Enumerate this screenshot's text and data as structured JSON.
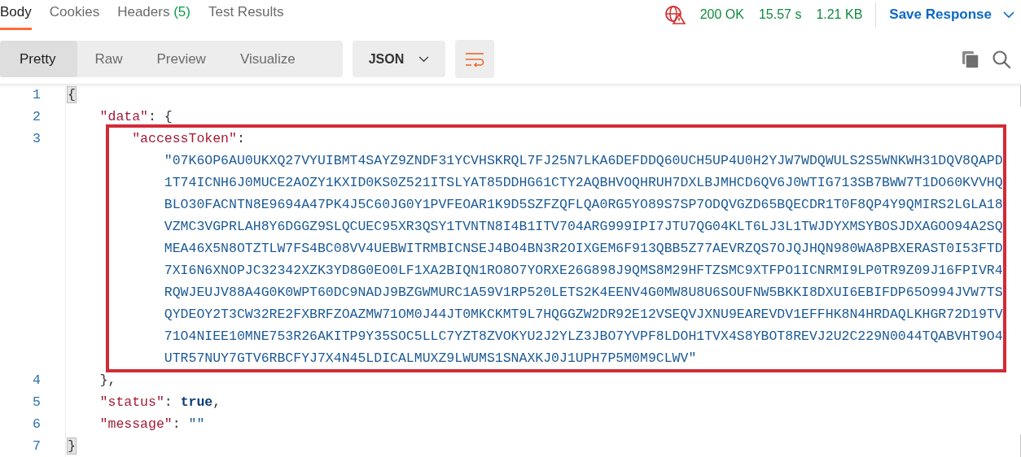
{
  "response_tabs": [
    {
      "label": "Body",
      "selected": true
    },
    {
      "label": "Cookies",
      "selected": false
    },
    {
      "label": "Headers",
      "count": "(5)",
      "selected": false
    },
    {
      "label": "Test Results",
      "selected": false
    }
  ],
  "response_status": {
    "code": "200 OK",
    "time": "15.57 s",
    "size": "1.21 KB"
  },
  "save_button": {
    "label": "Save Response"
  },
  "view_tabs": [
    {
      "label": "Pretty",
      "selected": true
    },
    {
      "label": "Raw",
      "selected": false
    },
    {
      "label": "Preview",
      "selected": false
    },
    {
      "label": "Visualize",
      "selected": false
    }
  ],
  "format_select": {
    "value": "JSON"
  },
  "wrap_toggle": {
    "on": true
  },
  "code": {
    "number": "1",
    "segments": [
      {
        "kind": "punct",
        "text": "{",
        "bracket_match": true
      }
    ],
    "children": [
      {
        "number": "2",
        "segments": [
          {
            "kind": "key",
            "text": "\"data\""
          },
          {
            "kind": "punct",
            "text": ": {"
          }
        ],
        "children": [
          {
            "number": "3",
            "highlighted": true,
            "segments": [
              {
                "kind": "key",
                "text": "\"accessToken\""
              },
              {
                "kind": "punct",
                "text": ":"
              }
            ],
            "wrapped_lines": [
              "\"07K6OP6AU0UKXQ27VYUIBMT4SAYZ9ZNDF31YCVHSKRQL7FJ25N7LKA6DEFDDQ60UCH5UP4U0H2YJW7WDQWULS2S5WNKWH31DQV8QAPD",
              "1T74ICNH6J0MUCE2AOZY1KXID0KS0Z521ITSLYAT85DDHG61CTY2AQBHVOQHRUH7DXLBJMHCD6QV6J0WTIG713SB7BWW7T1DO60KVVHQ",
              "BLO30FACNTN8E9694A47PK4J5C60JG0Y1PVFEOAR1K9D5SZFZQFLQA0RG5YO89S7SP7ODQVGZD65BQECDR1T0F8QP4Y9QMIRS2LGLA18",
              "VZMC3VGPRLAH8Y6DGGZ9SLQCUEC95XR3QSY1TVNTN8I4B1ITV704ARG999IPI7JTU7QG04KLT6LJ3L1TWJDYXMSYBOSJDXAGOO94A2SQ",
              "MEA46X5N8OTZTLW7FS4BC08VV4UEBWITRMBICNSEJ4BO4BN3R2OIXGEM6F913QBB5Z77AEVRZQS7OJQJHQN980WA8PBXERAST0I53FTD",
              "7XI6N6XNOPJC32342XZK3YD8G0EO0LF1XA2BIQN1RO8O7YORXE26G898J9QMS8M29HFTZSMC9XTFPO1ICNRMI9LP0TR9Z09J16FPIVR4",
              "RQWJEUJV88A4G0K0WPT60DC9NADJ9BZGWMURC1A59V1RP520LETS2K4EENV4G0MW8U8U6SOUFNW5BKKI8DXUI6EBIFDP65O994JVW7TS",
              "QYDEOY2T3CW32RE2FXBRFZOAZMW71OM0J44JT0MKCKMT9L7HQGGZW2DR92E12VSEQVJXNU9EAREVDV1EFFHK8N4HRDAQLKHGR72D19TV",
              "71O4NIEE10MNE753R26AKITP9Y35SOC5LLC7YZT8ZVOKYU2J2YLZ3JBO7YVPF8LDOH1TVX4S8YBOT8REVJ2U2C229N0044TQABVHT9O4",
              "UTR57NUY7GTV6RBCFYJ7X4N45LDICALMUXZ9LWUMS1SNAXKJ0J1UPH7P5M0M9CLWV\""
            ]
          }
        ],
        "close": {
          "number": "4",
          "segments": [
            {
              "kind": "punct",
              "text": "},"
            }
          ]
        }
      },
      {
        "number": "5",
        "segments": [
          {
            "kind": "key",
            "text": "\"status\""
          },
          {
            "kind": "punct",
            "text": ": "
          },
          {
            "kind": "boolean",
            "text": "true"
          },
          {
            "kind": "punct",
            "text": ","
          }
        ]
      },
      {
        "number": "6",
        "segments": [
          {
            "kind": "key",
            "text": "\"message\""
          },
          {
            "kind": "punct",
            "text": ": "
          },
          {
            "kind": "string",
            "text": "\"\""
          }
        ]
      }
    ],
    "close": {
      "number": "7",
      "segments": [
        {
          "kind": "punct",
          "text": "}",
          "bracket_match": true
        }
      ]
    }
  }
}
